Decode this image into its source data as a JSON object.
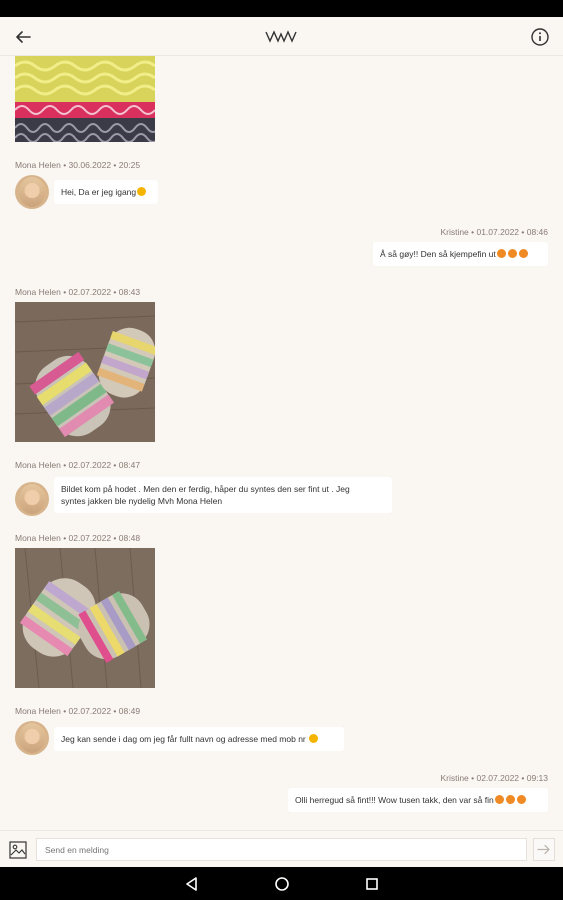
{
  "colors": {
    "background": "#faf7f3",
    "bubble": "#ffffff",
    "meta_text": "#8a7a74",
    "system_bar": "#000000"
  },
  "header": {
    "back_icon": "arrow-left-icon",
    "logo_icon": "knit-logo-icon",
    "info_icon": "info-icon"
  },
  "messages": [
    {
      "meta": "Mona Helen • 30.06.2022 • 20:25",
      "text": "Hei, Da er jeg igang"
    },
    {
      "meta": "Kristine • 01.07.2022 • 08:46",
      "text": "Å så gøy!! Den så kjempefin ut"
    },
    {
      "meta": "Mona Helen • 02.07.2022 • 08:43"
    },
    {
      "meta": "Mona Helen • 02.07.2022 • 08:47",
      "text_line1": "Bildet kom på hodet . Men den er ferdig, håper du syntes den ser fint ut . Jeg",
      "text_line2": "syntes jakken ble nydelig  Mvh Mona Helen"
    },
    {
      "meta": "Mona Helen • 02.07.2022 • 08:48"
    },
    {
      "meta": "Mona Helen • 02.07.2022 • 08:49",
      "text": "Jeg kan sende i dag om jeg får fullt navn og adresse med mob nr"
    },
    {
      "meta": "Kristine • 02.07.2022 • 09:13",
      "text": "Olli herregud så fint!!! Wow tusen takk, den var så fin"
    }
  ],
  "composer": {
    "placeholder": "Send en melding",
    "attach_icon": "image-icon",
    "send_icon": "arrow-right-icon"
  },
  "navbar": {
    "back": "triangle-back-icon",
    "home": "circle-home-icon",
    "recents": "square-recents-icon"
  }
}
